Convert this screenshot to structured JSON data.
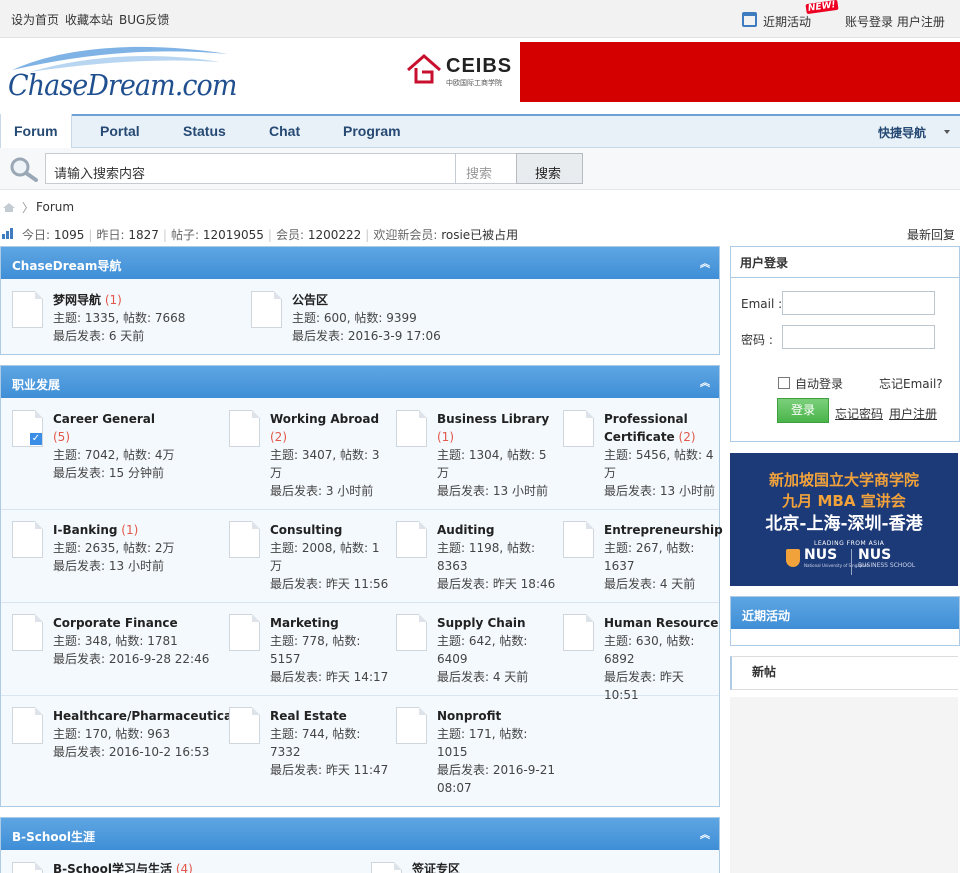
{
  "topbar": {
    "set_home": "设为首页",
    "bookmark": "收藏本站",
    "bug": "BUG反馈",
    "recent_events": "近期活动",
    "new_badge": "NEW!",
    "login": "账号登录",
    "register": "用户注册"
  },
  "brand": {
    "logo": "ChaseDream.com",
    "banner_brand": "CEIBS",
    "banner_sub": "中欧国际工商学院"
  },
  "nav": {
    "tabs": [
      "Forum",
      "Portal",
      "Status",
      "Chat",
      "Program"
    ],
    "active": "Forum",
    "quick_nav": "快捷导航"
  },
  "search": {
    "placeholder": "请输入搜索内容",
    "type": "搜索",
    "button": "搜索"
  },
  "breadcrumb": {
    "current": "Forum"
  },
  "stats": {
    "today_label": "今日:",
    "today": "1095",
    "yesterday_label": "昨日:",
    "yesterday": "1827",
    "posts_label": "帖子:",
    "posts": "12019055",
    "members_label": "会员:",
    "members": "1200222",
    "welcome_label": "欢迎新会员:",
    "newest": "rosie已被占用",
    "latest_reply": "最新回复"
  },
  "sections": [
    {
      "title": "ChaseDream导航",
      "forums": [
        {
          "name": "梦网导航",
          "new": "(1)",
          "l2": "主题: 1335, 帖数: 7668",
          "l3": "最后发表: 6 天前"
        },
        {
          "name": "公告区",
          "new": "",
          "l2": "主题: 600, 帖数: 9399",
          "l3": "最后发表: 2016-3-9 17:06"
        }
      ]
    },
    {
      "title": "职业发展",
      "forums": [
        {
          "name": "Career General",
          "new": "(5)",
          "lines": [
            "主题: 7042, 帖数: 4万",
            "最后发表: 15 分钟前"
          ]
        },
        {
          "name": "Working Abroad",
          "new": "(2)",
          "lines": [
            "主题: 3407, 帖数: 3",
            "万",
            "最后发表: 3 小时前"
          ]
        },
        {
          "name": "Business Library",
          "new": "(1)",
          "lines": [
            "主题: 1304, 帖数: 5",
            "万",
            "最后发表: 13 小时前"
          ]
        },
        {
          "name": "Professional",
          "name2": "Certificate",
          "new": "(2)",
          "lines": [
            "主题: 5456, 帖数: 4",
            "万",
            "最后发表: 13 小时前"
          ]
        },
        {
          "name": "I-Banking",
          "new": "(1)",
          "lines": [
            "主题: 2635, 帖数: 2万",
            "最后发表: 13 小时前"
          ]
        },
        {
          "name": "Consulting",
          "new": "",
          "lines": [
            "主题: 2008, 帖数: 1",
            "万",
            "最后发表: 昨天 11:56"
          ]
        },
        {
          "name": "Auditing",
          "new": "",
          "lines": [
            "主题: 1198, 帖数:",
            "8363",
            "最后发表: 昨天 18:46"
          ]
        },
        {
          "name": "Entrepreneurship",
          "new": "",
          "lines": [
            "主题: 267, 帖数:",
            "1637",
            "最后发表: 4 天前"
          ]
        },
        {
          "name": "Corporate Finance",
          "new": "",
          "lines": [
            "主题: 348, 帖数: 1781",
            "最后发表: 2016-9-28 22:46"
          ]
        },
        {
          "name": "Marketing",
          "new": "",
          "lines": [
            "主题: 778, 帖数:",
            "5157",
            "最后发表: 昨天 14:17"
          ]
        },
        {
          "name": "Supply Chain",
          "new": "",
          "lines": [
            "主题: 642, 帖数:",
            "6409",
            "最后发表: 4 天前"
          ]
        },
        {
          "name": "Human Resource",
          "new": "",
          "lines": [
            "主题: 630, 帖数:",
            "6892",
            "最后发表: 昨天 10:51"
          ]
        },
        {
          "name": "Healthcare/Pharmaceutical",
          "new": "",
          "lines": [
            "主题: 170, 帖数: 963",
            "最后发表: 2016-10-2 16:53"
          ]
        },
        {
          "name": "Real Estate",
          "new": "",
          "lines": [
            "主题: 744, 帖数:",
            "7332",
            "最后发表: 昨天 11:47"
          ]
        },
        {
          "name": "Nonprofit",
          "new": "",
          "lines": [
            "主题: 171, 帖数:",
            "1015",
            "最后发表: 2016-9-21",
            "08:07"
          ]
        }
      ]
    },
    {
      "title": "B-School生涯",
      "forums": [
        {
          "name": "B-School学习与生活",
          "new": "(4)"
        },
        {
          "name": "签证专区",
          "new": ""
        }
      ]
    }
  ],
  "login_box": {
    "title": "用户登录",
    "email_label": "Email :",
    "password_label": "密码 :",
    "auto_login": "自动登录",
    "forgot_email": "忘记Email?",
    "submit": "登录",
    "forgot_password": "忘记密码",
    "register": "用户注册"
  },
  "ad": {
    "line1": "新加坡国立大学商学院",
    "line2": "九月 MBA 宣讲会",
    "line3": "北京-上海-深圳-香港",
    "leading": "LEADING FROM ASIA",
    "nus": "NUS",
    "nus_small": "National University of Singapore",
    "nus_bs": "NUS",
    "bs": "BUSINESS SCHOOL"
  },
  "sidebar": {
    "recent_events": "近期活动",
    "new_posts": "新帖"
  }
}
